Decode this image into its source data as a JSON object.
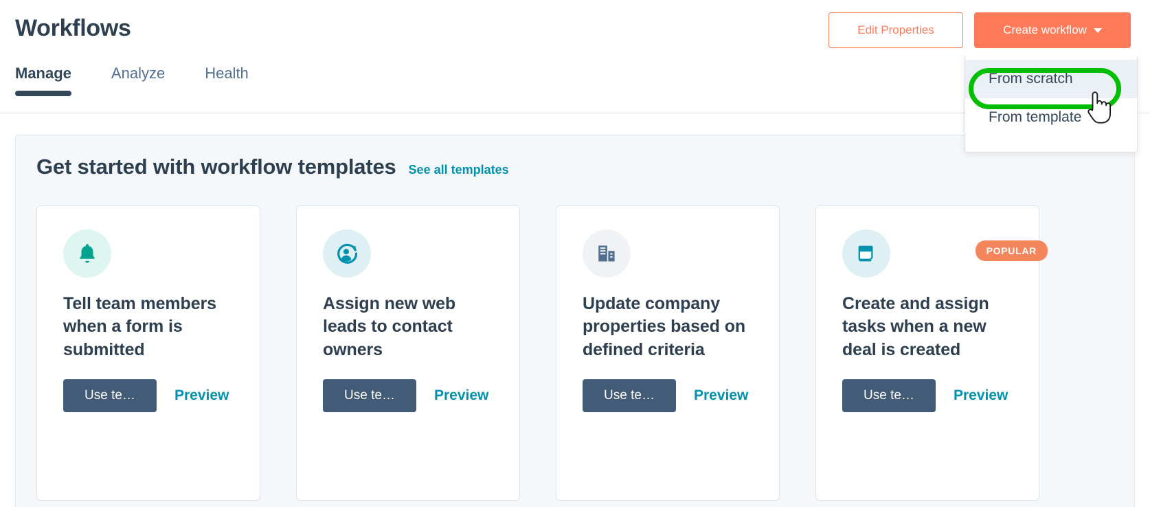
{
  "header": {
    "title": "Workflows",
    "actions": {
      "edit_properties_label": "Edit Properties",
      "create_workflow_label": "Create workflow"
    },
    "tabs": [
      {
        "label": "Manage",
        "active": true
      },
      {
        "label": "Analyze",
        "active": false
      },
      {
        "label": "Health",
        "active": false
      }
    ]
  },
  "dropdown": {
    "open": true,
    "items": [
      {
        "label": "From scratch",
        "hovered": true,
        "highlighted": true
      },
      {
        "label": "From template",
        "hovered": false,
        "highlighted": false
      }
    ],
    "highlight_color": "#00bf00",
    "hover_bg": "#eaf0f6"
  },
  "main": {
    "section_title": "Get started with workflow templates",
    "see_all_link": "See all templates",
    "cards": [
      {
        "icon": "bell-icon",
        "icon_color": "#00a38d",
        "icon_bg": "#dff5ef",
        "title": "Tell team members when a form is submitted",
        "use_label": "Use te…",
        "preview_label": "Preview",
        "badge": null
      },
      {
        "icon": "contact-rotation-icon",
        "icon_color": "#0091ae",
        "icon_bg": "#dff0f5",
        "title": "Assign new web leads to contact owners",
        "use_label": "Use te…",
        "preview_label": "Preview",
        "badge": null
      },
      {
        "icon": "company-building-icon",
        "icon_color": "#516f90",
        "icon_bg": "#f0f3f6",
        "title": "Update company properties based on defined criteria",
        "use_label": "Use te…",
        "preview_label": "Preview",
        "badge": null
      },
      {
        "icon": "notebook-icon",
        "icon_color": "#0091ae",
        "icon_bg": "#dff0f5",
        "title": "Create and assign tasks when a new deal is created",
        "use_label": "Use te…",
        "preview_label": "Preview",
        "badge": "POPULAR"
      }
    ]
  },
  "colors": {
    "brand_orange": "#ff7a59",
    "badge_orange": "#f5865c",
    "link_teal": "#0091ae",
    "dark_slate": "#33475b",
    "button_slate": "#425b76",
    "page_bg": "#f5f8fa"
  }
}
